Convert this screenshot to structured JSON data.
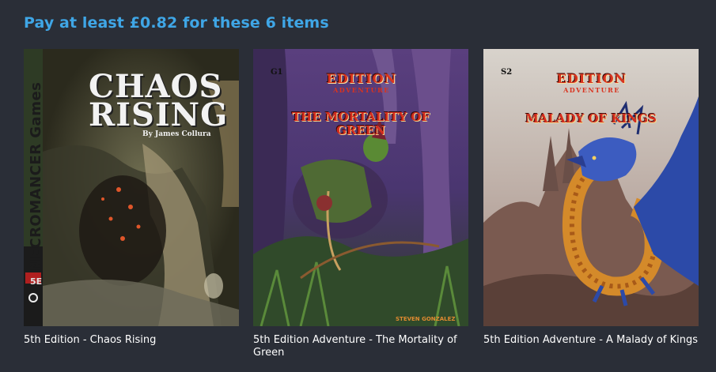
{
  "heading": "Pay at least £0.82 for these 6 items",
  "items": [
    {
      "title": "5th Edition - Chaos Rising",
      "cover": {
        "title": "CHAOS RISING",
        "author": "By James Collura",
        "side_text": "NECROMANCER Games",
        "badge": "5E"
      }
    },
    {
      "title": "5th Edition Adventure - The Mortality of Green",
      "cover": {
        "code": "G1",
        "logo": "EDITION",
        "logo_sub": "ADVENTURE",
        "title": "THE MORTALITY OF GREEN",
        "author": "STEVEN GONZALEZ"
      }
    },
    {
      "title": "5th Edition Adventure - A Malady of Kings",
      "cover": {
        "code": "S2",
        "logo": "EDITION",
        "logo_sub": "ADVENTURE",
        "title": "MALADY OF KINGS"
      }
    }
  ],
  "colors": {
    "background": "#2a2e37",
    "heading": "#3fa6e6",
    "title_text": "#ffffff"
  }
}
